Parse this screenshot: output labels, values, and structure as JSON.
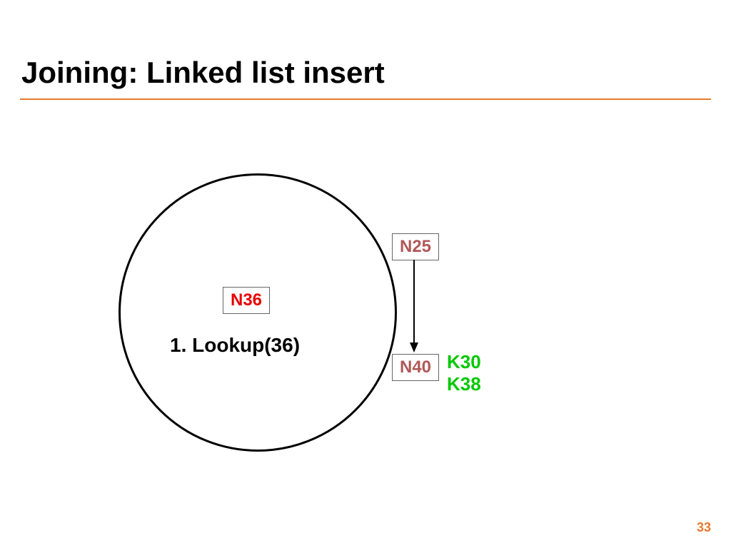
{
  "title": "Joining: Linked list insert",
  "nodes": {
    "n36": "N36",
    "n25": "N25",
    "n40": "N40"
  },
  "step": "1. Lookup(36)",
  "keys": {
    "k1": "K30",
    "k2": "K38"
  },
  "page_number": "33",
  "colors": {
    "accent": "#e8792b",
    "new_node": "#e80000",
    "existing_node": "#b05858",
    "keys": "#00c800"
  }
}
